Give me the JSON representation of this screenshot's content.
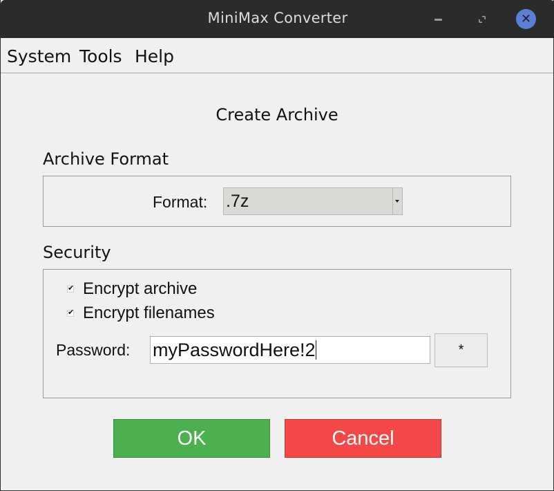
{
  "window": {
    "title": "MiniMax Converter",
    "controls": {
      "minimize_icon": "minimize-icon",
      "maximize_icon": "maximize-icon",
      "close_icon": "close-icon",
      "close_glyph": "✕"
    }
  },
  "menubar": {
    "items": [
      {
        "label": "System"
      },
      {
        "label": "Tools"
      },
      {
        "label": "Help"
      }
    ]
  },
  "dialog": {
    "title": "Create Archive",
    "archive_format": {
      "section_label": "Archive Format",
      "format_label": "Format:",
      "format_value": ".7z"
    },
    "security": {
      "section_label": "Security",
      "encrypt_archive": {
        "label": "Encrypt archive",
        "checked": true
      },
      "encrypt_filenames": {
        "label": "Encrypt filenames",
        "checked": true
      },
      "password_label": "Password:",
      "password_value": "myPasswordHere!2",
      "mask_button_label": "*"
    },
    "buttons": {
      "ok_label": "OK",
      "cancel_label": "Cancel"
    }
  },
  "colors": {
    "titlebar": "#2b2b2b",
    "window_bg": "#f0f0f0",
    "close_button": "#5b7fd4",
    "ok_button": "#4caf50",
    "cancel_button": "#f44848"
  }
}
